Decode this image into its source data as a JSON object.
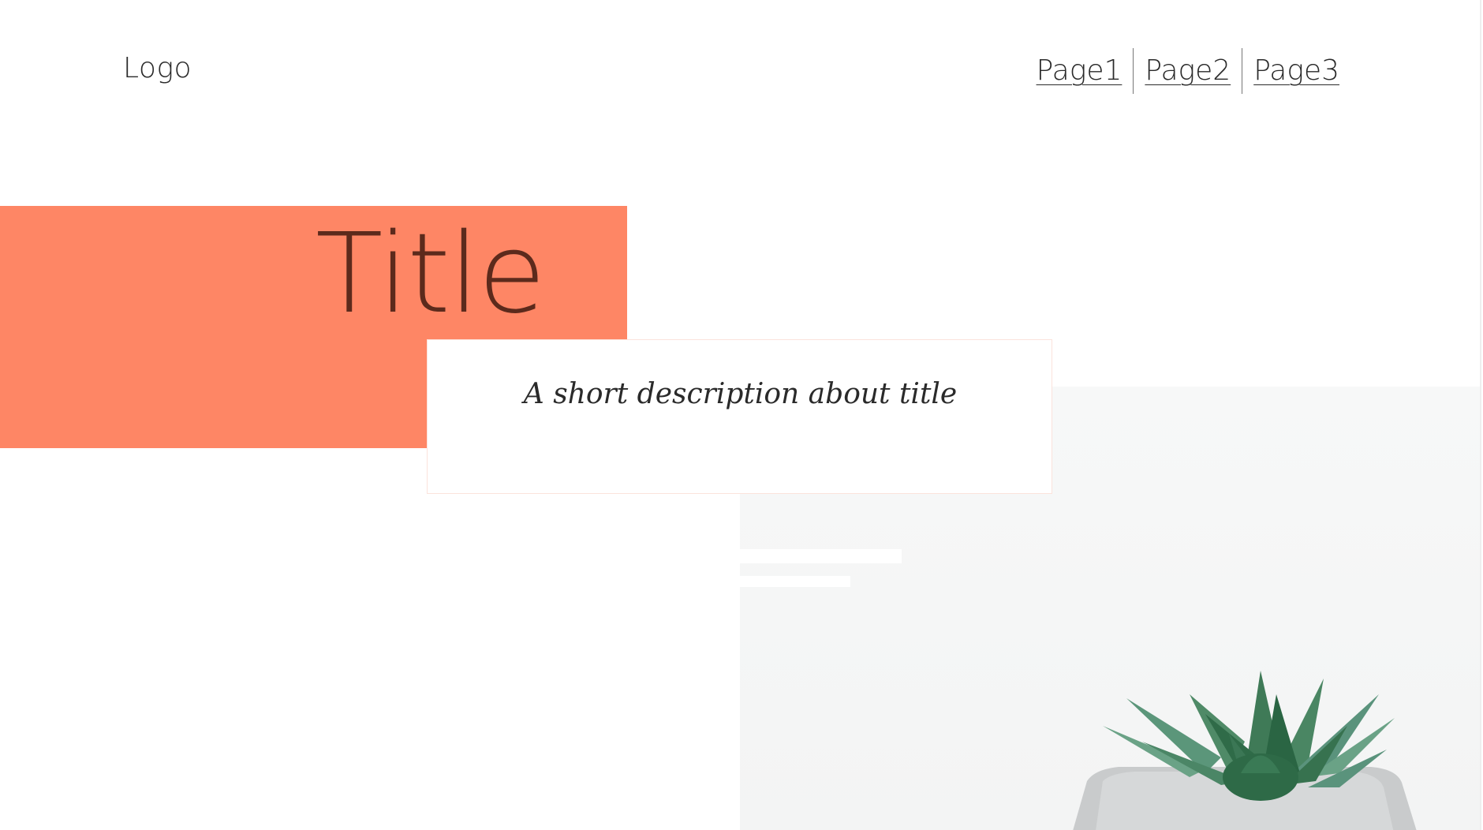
{
  "header": {
    "logo_text": "Logo",
    "nav": [
      {
        "label": "Page1"
      },
      {
        "label": "Page2"
      },
      {
        "label": "Page3"
      }
    ]
  },
  "hero": {
    "title": "Title",
    "description": "A short description about title"
  },
  "colors": {
    "accent": "#fe8665",
    "title_text": "#5c2a1c",
    "text": "#2a2a2a"
  },
  "image": {
    "icon": "succulent-plant-photo"
  }
}
